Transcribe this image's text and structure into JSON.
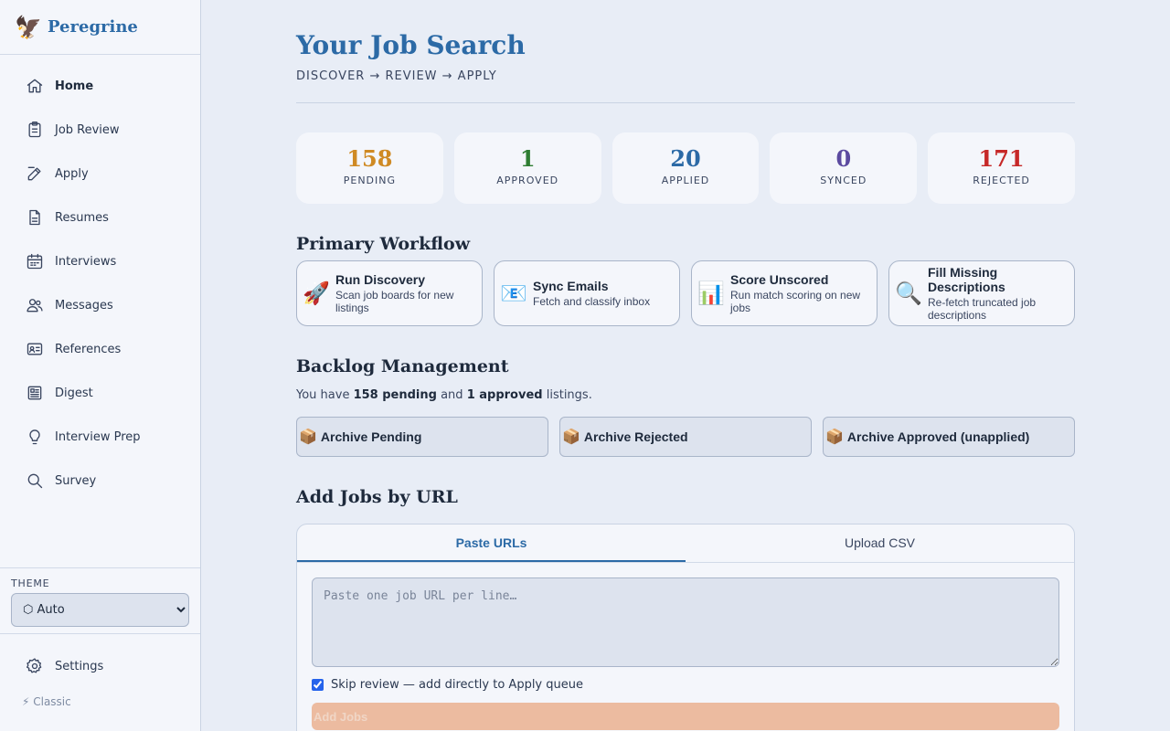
{
  "brand": {
    "icon": "🦅",
    "name": "Peregrine"
  },
  "nav": [
    {
      "label": "Home",
      "icon": "home-icon",
      "active": true
    },
    {
      "label": "Job Review",
      "icon": "clipboard-icon"
    },
    {
      "label": "Apply",
      "icon": "pencil-icon"
    },
    {
      "label": "Resumes",
      "icon": "document-icon"
    },
    {
      "label": "Interviews",
      "icon": "calendar-icon"
    },
    {
      "label": "Messages",
      "icon": "users-icon"
    },
    {
      "label": "References",
      "icon": "id-card-icon"
    },
    {
      "label": "Digest",
      "icon": "newspaper-icon"
    },
    {
      "label": "Interview Prep",
      "icon": "lightbulb-icon"
    },
    {
      "label": "Survey",
      "icon": "search-icon"
    }
  ],
  "theme": {
    "label": "THEME",
    "selected": "⬡ Auto"
  },
  "settings": {
    "label": "Settings",
    "icon": "gear-icon"
  },
  "classic": "⚡ Classic",
  "header": {
    "title": "Your Job Search",
    "subtitle": "DISCOVER → REVIEW → APPLY"
  },
  "stats": [
    {
      "value": "158",
      "label": "PENDING",
      "color": "#cf8a24"
    },
    {
      "value": "1",
      "label": "APPROVED",
      "color": "#2e7d32"
    },
    {
      "value": "20",
      "label": "APPLIED",
      "color": "#2c6aa6"
    },
    {
      "value": "0",
      "label": "SYNCED",
      "color": "#5b4aa0"
    },
    {
      "value": "171",
      "label": "REJECTED",
      "color": "#c62828"
    }
  ],
  "workflow": {
    "title": "Primary Workflow",
    "cards": [
      {
        "icon": "🚀",
        "title": "Run Discovery",
        "desc": "Scan job boards for new listings"
      },
      {
        "icon": "📧",
        "title": "Sync Emails",
        "desc": "Fetch and classify inbox"
      },
      {
        "icon": "📊",
        "title": "Score Unscored",
        "desc": "Run match scoring on new jobs"
      },
      {
        "icon": "🔍",
        "title": "Fill Missing Descriptions",
        "desc": "Re-fetch truncated job descriptions"
      }
    ]
  },
  "backlog": {
    "title": "Backlog Management",
    "summary": {
      "prefix": "You have ",
      "pending": "158 pending",
      "mid": " and ",
      "approved": "1 approved",
      "suffix": " listings."
    },
    "buttons": [
      {
        "icon": "📦",
        "label": "Archive Pending"
      },
      {
        "icon": "📦",
        "label": "Archive Rejected"
      },
      {
        "icon": "📦",
        "label": "Archive Approved (unapplied)"
      }
    ]
  },
  "add_jobs": {
    "title": "Add Jobs by URL",
    "tabs": [
      "Paste URLs",
      "Upload CSV"
    ],
    "placeholder": "Paste one job URL per line…",
    "skip_label": "Skip review — add directly to Apply queue",
    "skip_checked": true,
    "button_label": "Add Jobs"
  }
}
